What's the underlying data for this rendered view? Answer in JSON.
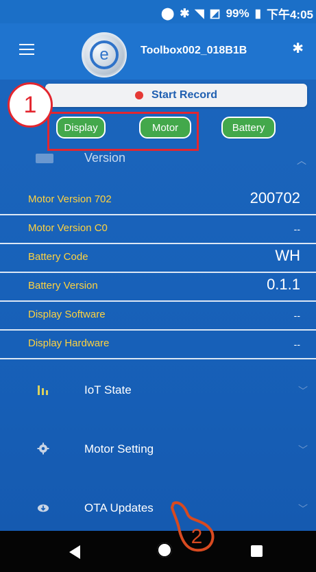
{
  "status_bar": {
    "icons": [
      "location-icon",
      "bluetooth-icon",
      "wifi-icon",
      "no-sim-icon",
      "battery-icon"
    ],
    "battery": "99%",
    "time": "下午4:05"
  },
  "header": {
    "device_name": "Toolbox002_018B1B",
    "logo_letter": "e"
  },
  "toolbar": {
    "record_label": "Start Record",
    "tabs": [
      "Display",
      "Motor",
      "Battery"
    ]
  },
  "version": {
    "title": "Version",
    "rows": [
      {
        "label": "Motor Version 702",
        "value": "200702"
      },
      {
        "label": "Motor Version C0",
        "value": "--"
      },
      {
        "label": "Battery Code",
        "value": "WH"
      },
      {
        "label": "Battery Version",
        "value": "0.1.1"
      },
      {
        "label": "Display Software",
        "value": "--"
      },
      {
        "label": "Display Hardware",
        "value": "--"
      }
    ]
  },
  "sections": [
    {
      "title": "IoT State",
      "icon": "chart-bars-icon"
    },
    {
      "title": "Motor Setting",
      "icon": "gear-icon"
    },
    {
      "title": "OTA Updates",
      "icon": "cloud-download-icon"
    }
  ],
  "annotations": {
    "step1": "1",
    "step2": "2"
  },
  "colors": {
    "accent_blue": "#1f74cf",
    "tab_green": "#43a84b",
    "label_yellow": "#ffd23f",
    "annotation_red": "#e3262f"
  }
}
